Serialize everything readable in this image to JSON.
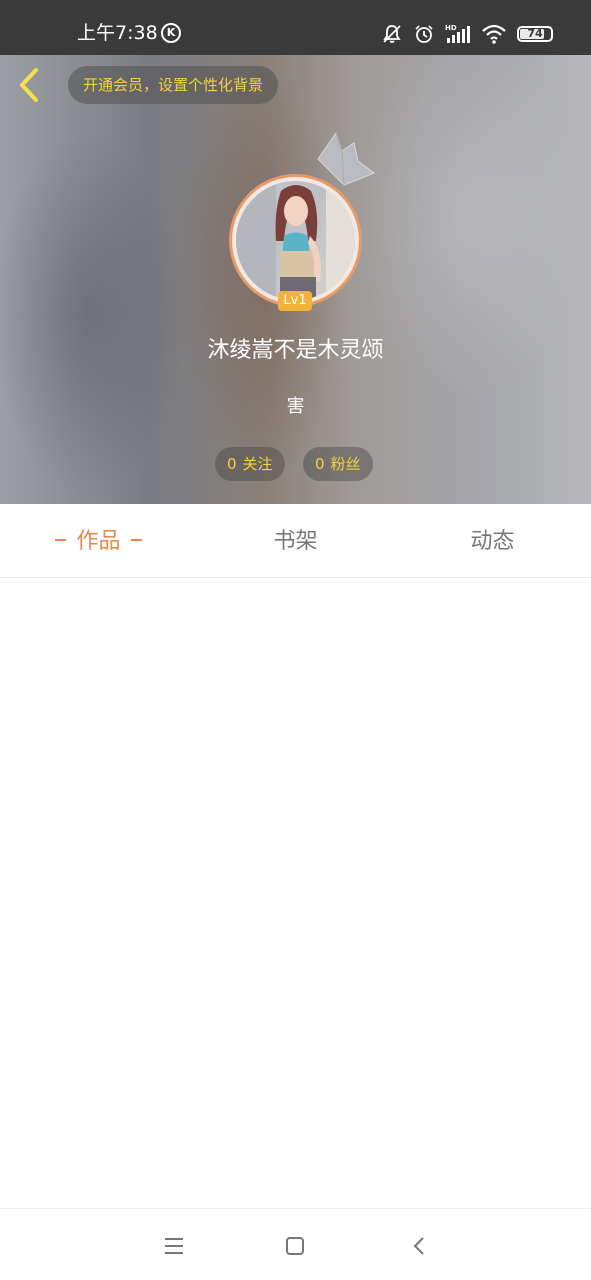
{
  "status_bar": {
    "time": "上午7:38",
    "k_badge": "K",
    "battery_level": "74",
    "icons": [
      "mute-bell-icon",
      "alarm-icon",
      "hd-signal-icon",
      "wifi-icon",
      "battery-icon"
    ]
  },
  "header": {
    "vip_banner": "开通会员，设置个性化背景",
    "username": "沐绫嵩不是木灵颂",
    "signature": "害",
    "level": "Lv1",
    "follow": {
      "count": "0",
      "label": "关注"
    },
    "fans": {
      "count": "0",
      "label": "粉丝"
    }
  },
  "tabs": [
    {
      "label": "作品",
      "active": true
    },
    {
      "label": "书架",
      "active": false
    },
    {
      "label": "动态",
      "active": false
    }
  ],
  "nav_bar": {
    "icons": [
      "menu-icon",
      "home-icon",
      "back-icon"
    ]
  },
  "colors": {
    "accent": "#e8894f",
    "gold": "#f5d33a",
    "badge": "#f3b23a",
    "status_bar": "#3a3a3a"
  }
}
